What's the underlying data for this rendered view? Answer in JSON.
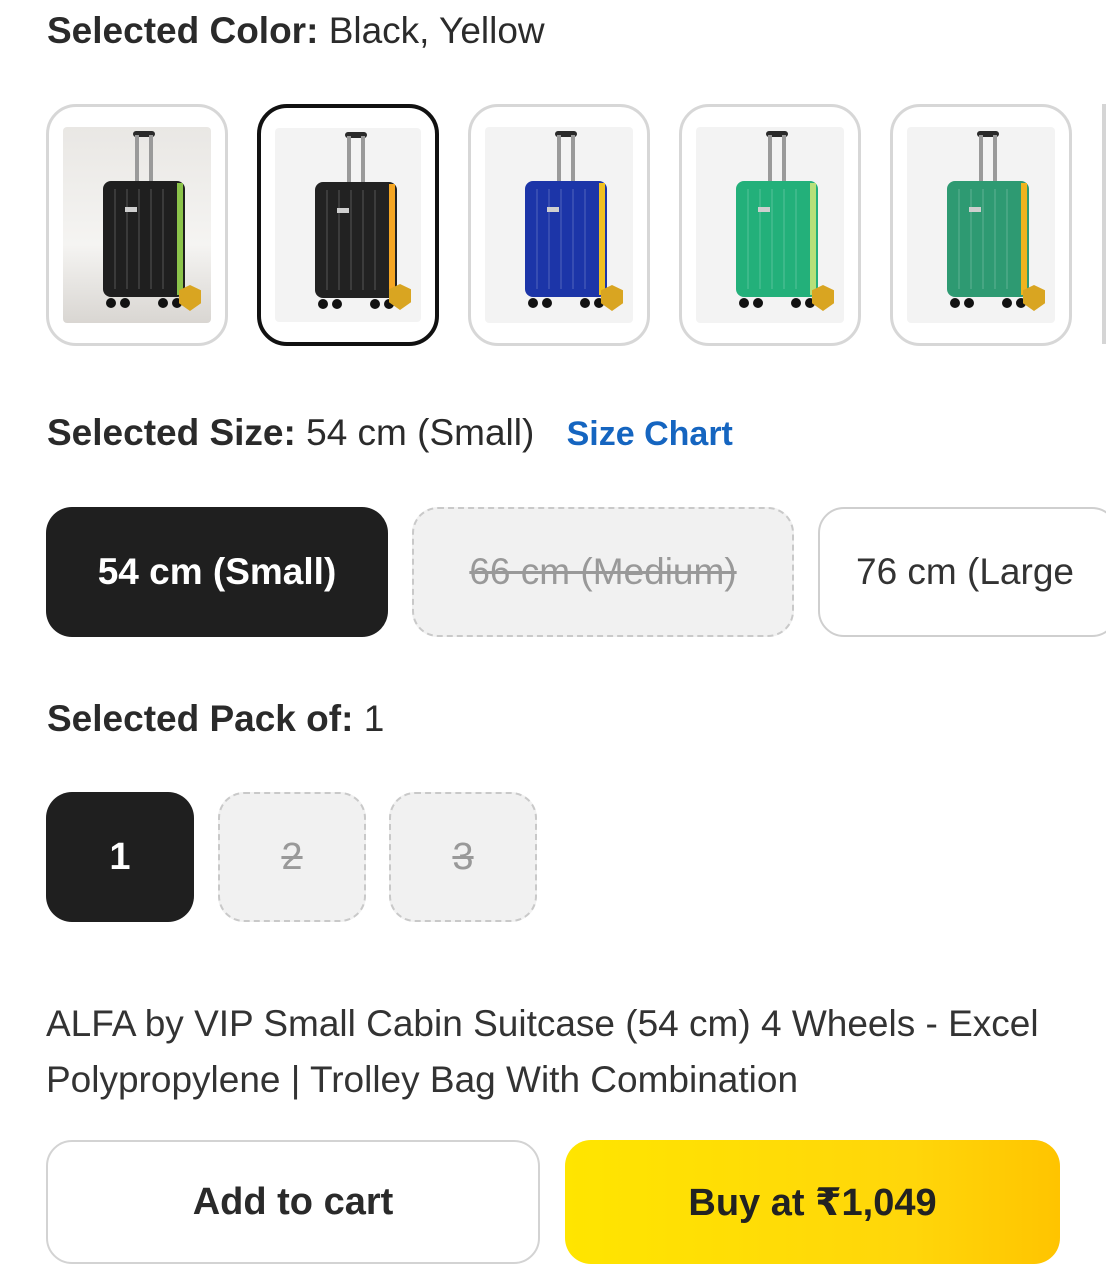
{
  "color": {
    "label": "Selected Color:",
    "value": "Black, Yellow"
  },
  "swatches": [
    {
      "name": "black-green",
      "body": "#1f1f1f",
      "trim": "#8bc34a",
      "selected": false
    },
    {
      "name": "black-yellow",
      "body": "#222222",
      "trim": "#f5a623",
      "selected": true
    },
    {
      "name": "blue-yellow",
      "body": "#1c35a8",
      "trim": "#f0c020",
      "selected": false
    },
    {
      "name": "green",
      "body": "#23b07a",
      "trim": "#b6e07a",
      "selected": false
    },
    {
      "name": "teal-yellow",
      "body": "#2e9a72",
      "trim": "#f0b41e",
      "selected": false
    }
  ],
  "size": {
    "label": "Selected Size:",
    "value": "54 cm (Small)",
    "chart_link": "Size Chart",
    "options": [
      {
        "label": "54 cm (Small)"
      },
      {
        "label": "66 cm (Medium)"
      },
      {
        "label": "76 cm (Large"
      }
    ]
  },
  "pack": {
    "label": "Selected Pack of:",
    "value": "1",
    "options": [
      {
        "label": "1"
      },
      {
        "label": "2"
      },
      {
        "label": "3"
      }
    ]
  },
  "product_title": "ALFA by VIP Small Cabin Suitcase (54 cm) 4 Wheels - Excel Polypropylene | Trolley Bag With Combination",
  "actions": {
    "add_to_cart": "Add to cart",
    "buy": "Buy at ₹1,049"
  },
  "colors": {
    "accent_link": "#1565c0",
    "buy_button": "#ffdb00",
    "selected_chip": "#1f1f1f"
  }
}
